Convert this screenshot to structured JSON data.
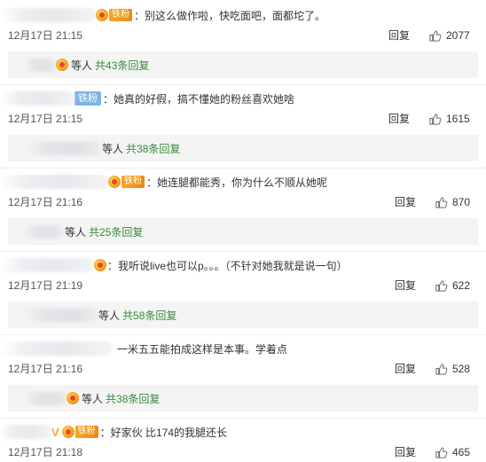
{
  "labels": {
    "reply": "回复",
    "others": "等人"
  },
  "colors": {
    "link_green": "#3a8a3a",
    "fan_tag": "#f4a623",
    "tie_fan_tag": "#7fb3e6",
    "thumb_icon": "#6b6f75"
  },
  "comments": [
    {
      "text": "：别这么做作啦，快吃面吧，面都坨了。",
      "badge": "铁粉",
      "time": "12月17日 21:15",
      "likes": "2077",
      "sub": "共43条回复"
    },
    {
      "text": "：她真的好假，搞不懂她的粉丝喜欢她啥",
      "badge": "铁粉",
      "time": "12月17日 21:15",
      "likes": "1615",
      "sub": "共38条回复"
    },
    {
      "text": "：她连腿都能秀，你为什么不顺从她呢",
      "badge": "铁粉",
      "time": "12月17日 21:16",
      "likes": "870",
      "sub": "共25条回复"
    },
    {
      "text": "：我听说live也可以p。。。（不针对她我就是说一句）",
      "badge": "",
      "time": "12月17日 21:19",
      "likes": "622",
      "sub": "共58条回复"
    },
    {
      "text": "一米五五能拍成这样是本事。学着点",
      "badge": "",
      "time": "12月17日 21:16",
      "likes": "528",
      "sub": "共38条回复"
    },
    {
      "text": "：好家伙 比174的我腿还长",
      "badge": "铁粉",
      "time": "12月17日 21:18",
      "likes": "465",
      "sub": ""
    }
  ]
}
